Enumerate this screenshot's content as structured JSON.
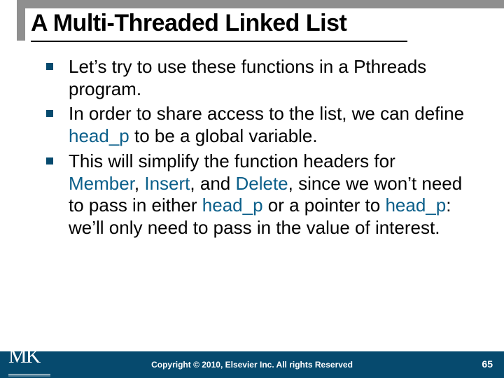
{
  "title": "A Multi-Threaded Linked List",
  "bullets": [
    {
      "segments": [
        {
          "t": "Let’s try to use these functions in a Pthreads program."
        }
      ]
    },
    {
      "segments": [
        {
          "t": "In order to share access to the list, we can define "
        },
        {
          "t": "head_p",
          "kw": true
        },
        {
          "t": " to be a global variable."
        }
      ]
    },
    {
      "segments": [
        {
          "t": "This will simplify the function headers for "
        },
        {
          "t": "Member",
          "kw": true
        },
        {
          "t": ", "
        },
        {
          "t": "Insert",
          "kw": true
        },
        {
          "t": ", and "
        },
        {
          "t": "Delete",
          "kw": true
        },
        {
          "t": ", since we won’t need to pass in either "
        },
        {
          "t": "head_p",
          "kw": true
        },
        {
          "t": " or a pointer to "
        },
        {
          "t": "head_p",
          "kw": true
        },
        {
          "t": ": we’ll only need to pass in the value of interest."
        }
      ]
    }
  ],
  "logo_text": "MK",
  "copyright": "Copyright © 2010, Elsevier Inc. All rights Reserved",
  "page_number": "65"
}
